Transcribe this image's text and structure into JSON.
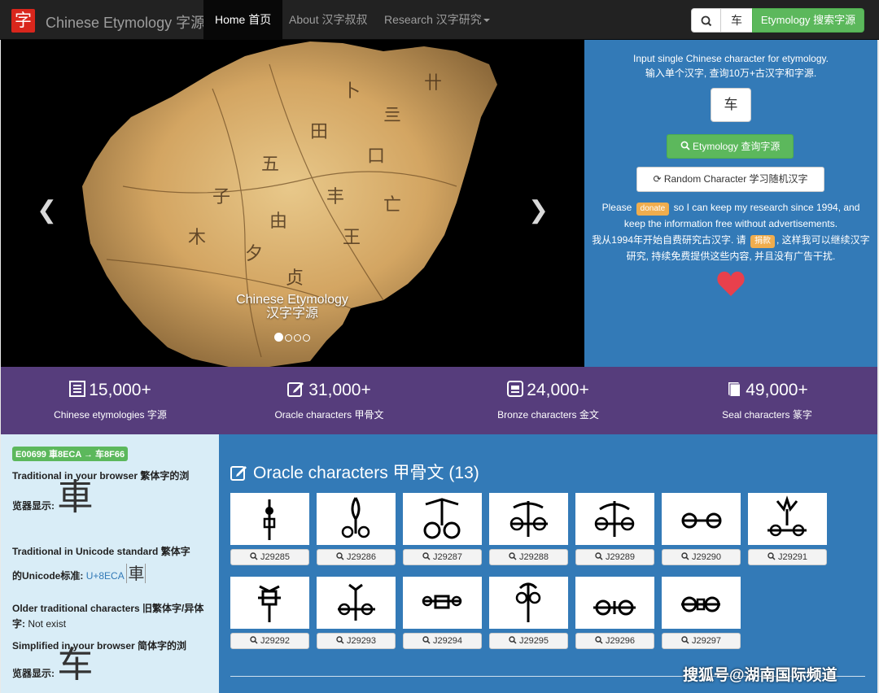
{
  "navbar": {
    "logo_char": "字",
    "brand": "Chinese Etymology 字源",
    "items": [
      {
        "label": "Home 首页",
        "active": true
      },
      {
        "label": "About 汉字叔叔",
        "active": false
      },
      {
        "label": "Research 汉字研究",
        "active": false
      }
    ],
    "search_value": "车",
    "search_button": "Etymology 搜索字源",
    "search_icon": "search-icon"
  },
  "carousel": {
    "caption_line1": "Chinese Etymology",
    "caption_line2": "汉字字源",
    "slide_count": 4,
    "active_slide": 1
  },
  "side_panel": {
    "intro_line1": "Input single Chinese character for etymology.",
    "intro_line2": "输入单个汉字, 查询10万+古汉字和字源.",
    "input_value": "车",
    "etym_button": "Etymology 查询字源",
    "random_button": "Random Character 学习随机汉字",
    "donate_pre": "Please",
    "donate_badge": "donate",
    "donate_post": "so I can keep my research since 1994, and keep the information free without advertisements.",
    "donate_cn_pre": "我从1994年开始自费研究古汉字. 请",
    "donate_cn_badge": "捐款",
    "donate_cn_post": ", 这样我可以继续汉字研究, 持续免费提供这些内容, 并且没有广告干扰.",
    "heart_color": "#e8404c"
  },
  "stats": [
    {
      "number": "15,000+",
      "label": "Chinese etymologies 字源",
      "icon": "list-icon"
    },
    {
      "number": "31,000+",
      "label": "Oracle characters 甲骨文",
      "icon": "edit-icon"
    },
    {
      "number": "24,000+",
      "label": "Bronze characters 金文",
      "icon": "bronze-icon"
    },
    {
      "number": "49,000+",
      "label": "Seal characters 篆字",
      "icon": "book-icon"
    }
  ],
  "info": {
    "code": "E00699 車8ECA → 车8F66",
    "trad_browser_label": "Traditional in your browser 繁体字的浏",
    "trad_browser_label2": "览器显示:",
    "trad_char": "車",
    "trad_unicode_label": "Traditional in Unicode standard 繁体字",
    "trad_unicode_label2": "的Unicode标准:",
    "trad_unicode_code": "U+8ECA",
    "trad_unicode_char": "車",
    "older_label": "Older traditional characters 旧繁体字/异体字:",
    "older_value": "Not exist",
    "simp_label": "Simplified in your browser 简体字的浏",
    "simp_label2": "览器显示:",
    "simp_char": "车"
  },
  "oracle": {
    "title": "Oracle characters 甲骨文 (13)",
    "items": [
      {
        "id": "J29285"
      },
      {
        "id": "J29286"
      },
      {
        "id": "J29287"
      },
      {
        "id": "J29288"
      },
      {
        "id": "J29289"
      },
      {
        "id": "J29290"
      },
      {
        "id": "J29291"
      },
      {
        "id": "J29292"
      },
      {
        "id": "J29293"
      },
      {
        "id": "J29294"
      },
      {
        "id": "J29295"
      },
      {
        "id": "J29296"
      },
      {
        "id": "J29297"
      }
    ]
  },
  "watermark": "搜狐号@湖南国际频道"
}
